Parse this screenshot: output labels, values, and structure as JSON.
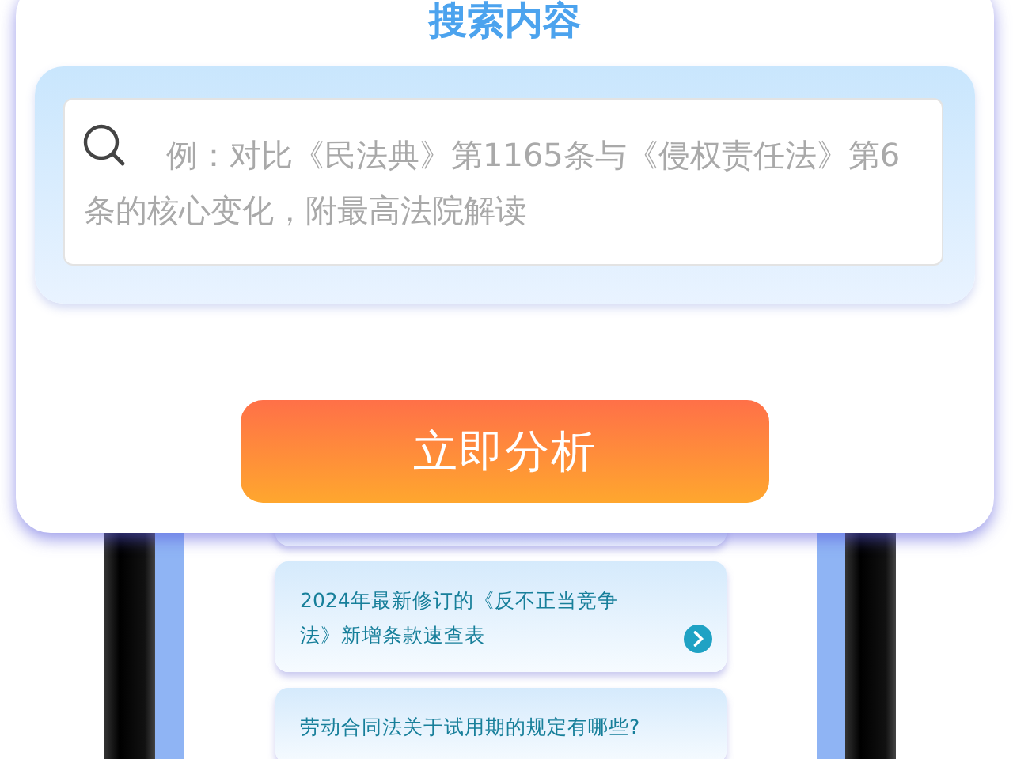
{
  "title": "搜索内容",
  "search": {
    "placeholder": "例：对比《民法典》第1165条与《侵权责任法》第6条的核心变化，附最高法院解读"
  },
  "analyze_button": "立即分析",
  "suggestions": [
    {
      "text": "2024年最新修订的《反不正当竞争法》新增条款速查表",
      "has_arrow": true
    },
    {
      "text": "劳动合同法关于试用期的规定有哪些?",
      "has_arrow": false
    }
  ]
}
